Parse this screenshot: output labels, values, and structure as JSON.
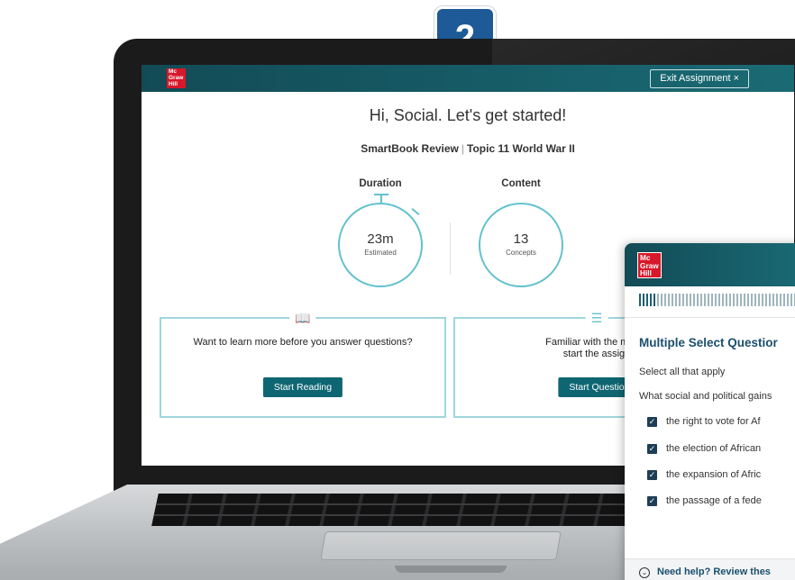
{
  "step_badge": "2",
  "laptop_app": {
    "logo": "Mc\nGraw\nHill",
    "exit_button": "Exit Assignment  ×",
    "greeting": "Hi, Social. Let's get started!",
    "title": "SmartBook Review",
    "separator": "|",
    "topic": "Topic 11 World War II",
    "duration": {
      "label": "Duration",
      "value": "23m",
      "caption": "Estimated"
    },
    "content": {
      "label": "Content",
      "value": "13",
      "caption": "Concepts"
    },
    "reading_card": {
      "prompt": "Want to learn more before you answer questions?",
      "button": "Start Reading",
      "icon": "book-icon"
    },
    "questions_card": {
      "prompt_line1": "Familiar with the materi",
      "prompt_line2": "start the assign",
      "button": "Start Questio",
      "icon": "list-icon"
    }
  },
  "question_panel": {
    "logo": "Mc\nGraw\nHill",
    "progress_fraction": 0.1,
    "heading": "Multiple Select Questior",
    "instruction": "Select all that apply",
    "question": "What social and political gains",
    "options": [
      {
        "text": "the right to vote for Af",
        "checked": true
      },
      {
        "text": "the election of African",
        "checked": true
      },
      {
        "text": "the expansion of Afric",
        "checked": true
      },
      {
        "text": "the passage of a fede",
        "checked": true
      }
    ],
    "help": "Need help? Review thes"
  },
  "colors": {
    "header_teal": "#124b56",
    "accent_teal": "#62c1cd",
    "button_teal": "#0f6673",
    "mh_red": "#d7182a",
    "badge_blue": "#1d5a97",
    "heading_navy": "#1b4f6e"
  }
}
